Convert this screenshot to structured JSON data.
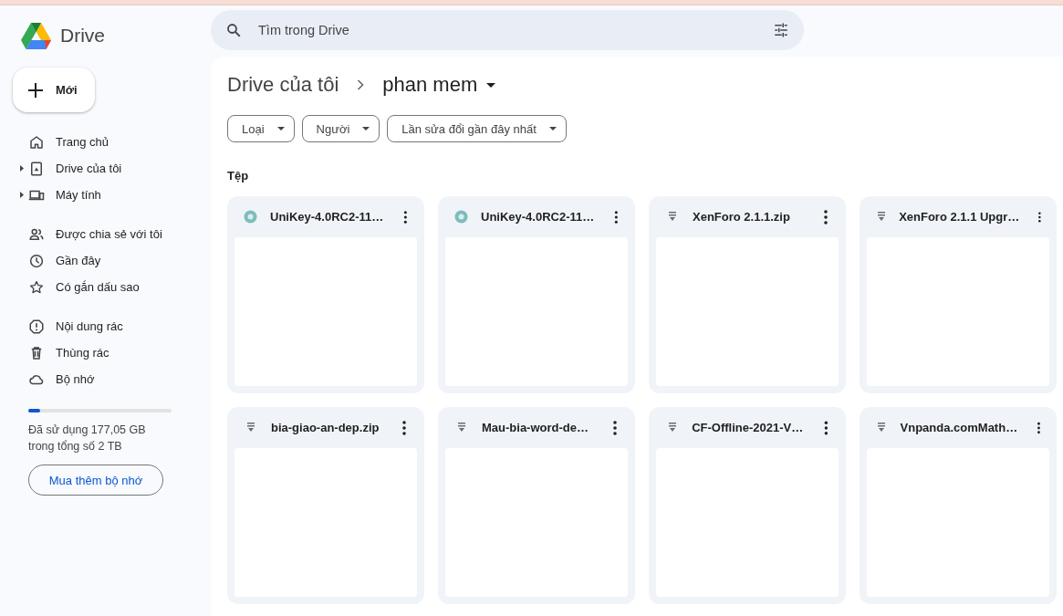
{
  "app": {
    "name": "Drive"
  },
  "new_button": {
    "label": "Mới"
  },
  "search": {
    "placeholder": "Tìm trong Drive"
  },
  "sidebar": {
    "groups": [
      {
        "items": [
          {
            "label": "Trang chủ",
            "expandable": false
          },
          {
            "label": "Drive của tôi",
            "expandable": true
          },
          {
            "label": "Máy tính",
            "expandable": true
          }
        ]
      },
      {
        "items": [
          {
            "label": "Được chia sẻ với tôi",
            "expandable": false
          },
          {
            "label": "Gần đây",
            "expandable": false
          },
          {
            "label": "Có gắn dấu sao",
            "expandable": false
          }
        ]
      },
      {
        "items": [
          {
            "label": "Nội dung rác",
            "expandable": false
          },
          {
            "label": "Thùng rác",
            "expandable": false
          },
          {
            "label": "Bộ nhớ",
            "expandable": false
          }
        ]
      }
    ]
  },
  "storage": {
    "level": 0.08,
    "used_text": "Đã sử dụng 177,05 GB trong tổng số 2 TB",
    "button": "Mua thêm bộ nhớ"
  },
  "breadcrumb": [
    {
      "label": "Drive của tôi"
    },
    {
      "label": "phan mem"
    }
  ],
  "filters": [
    {
      "label": "Loại"
    },
    {
      "label": "Người"
    },
    {
      "label": "Lần sửa đổi gần đây nhất"
    }
  ],
  "section_title": "Tệp",
  "files": [
    {
      "name": "UniKey-4.0RC2-11…",
      "kind": "disc"
    },
    {
      "name": "UniKey-4.0RC2-11…",
      "kind": "disc"
    },
    {
      "name": "XenForo 2.1.1.zip",
      "kind": "archive"
    },
    {
      "name": "XenForo 2.1.1 Upgr…",
      "kind": "archive"
    },
    {
      "name": "bia-giao-an-dep.zip",
      "kind": "archive"
    },
    {
      "name": "Mau-bia-word-de…",
      "kind": "archive"
    },
    {
      "name": "CF-Offline-2021-V…",
      "kind": "archive"
    },
    {
      "name": "Vnpanda.comMath…",
      "kind": "archive"
    }
  ]
}
